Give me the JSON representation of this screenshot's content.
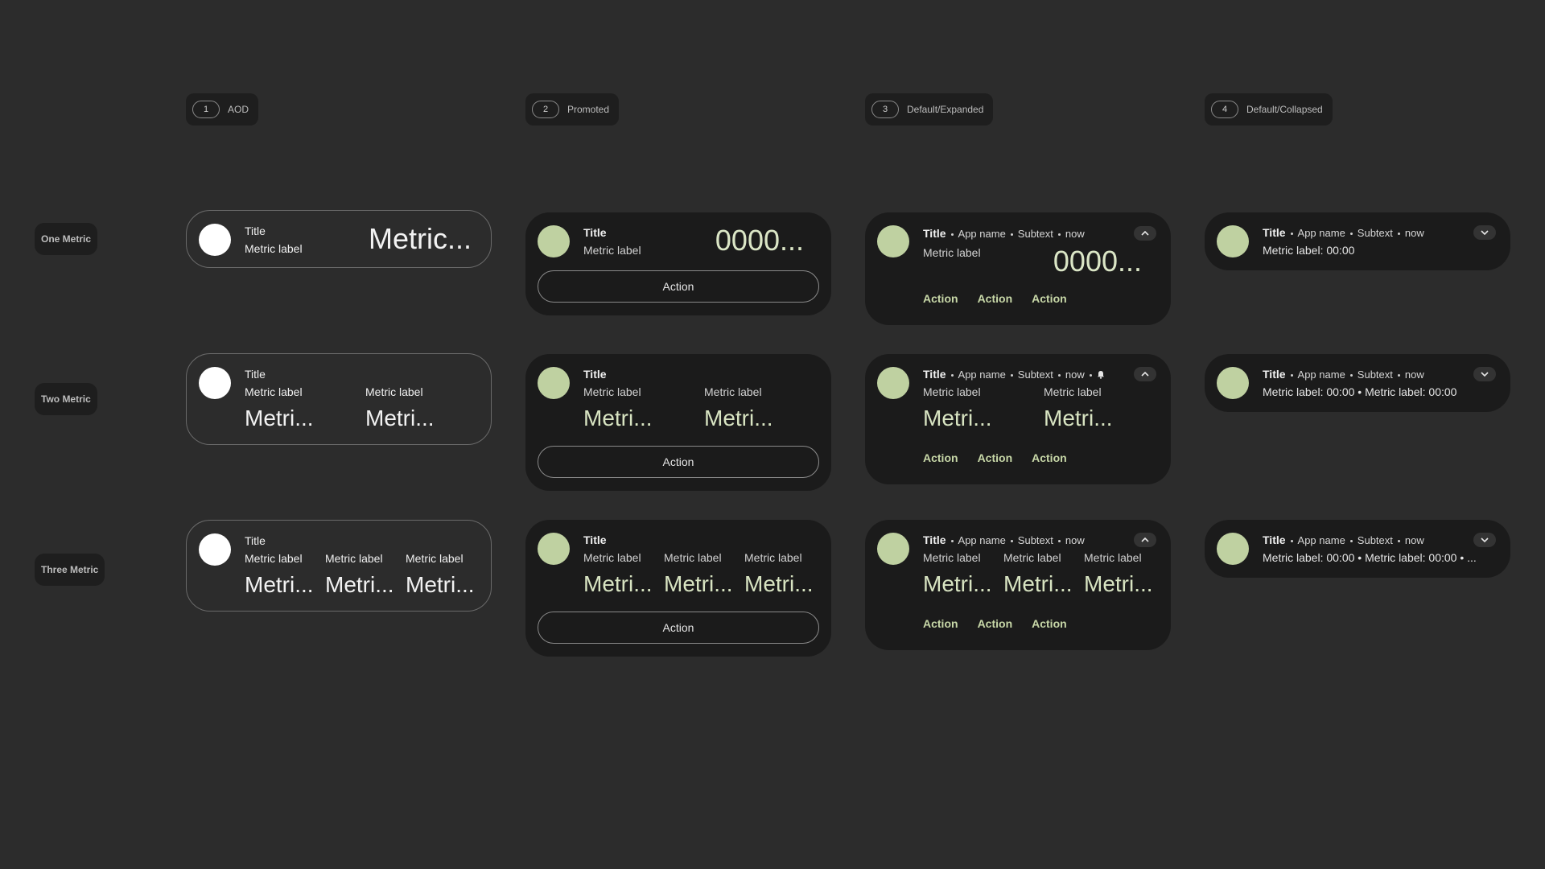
{
  "columns": [
    {
      "num": "1",
      "label": "AOD"
    },
    {
      "num": "2",
      "label": "Promoted"
    },
    {
      "num": "3",
      "label": "Default/Expanded"
    },
    {
      "num": "4",
      "label": "Default/Collapsed"
    }
  ],
  "rows": [
    "One Metric",
    "Two Metric",
    "Three Metric"
  ],
  "common": {
    "title": "Title",
    "metric_label": "Metric label",
    "metric_value_one_aod": "Metric...",
    "metric_value_one": "0000...",
    "metric_value_short": "Metri...",
    "action": "Action",
    "app_name": "App name",
    "subtext": "Subtext",
    "now": "now"
  },
  "collapsed": {
    "one": "Metric label: 00:00",
    "two": "Metric label: 00:00 • Metric label: 00:00",
    "three": "Metric label: 00:00 • Metric label: 00:00 • ..."
  },
  "colors": {
    "background": "#2c2c2c",
    "card": "#1b1b1b",
    "accent_green": "#bfd1a1",
    "action_green": "#c8d8a8"
  },
  "icons": [
    "chevron-up-icon",
    "chevron-down-icon",
    "bell-icon"
  ]
}
